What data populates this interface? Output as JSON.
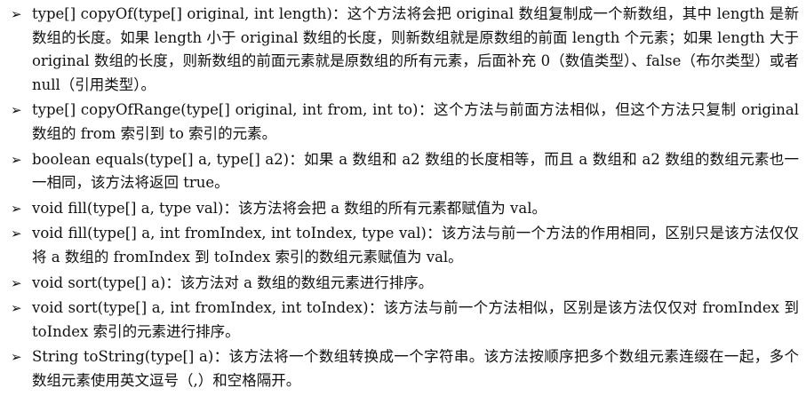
{
  "document": {
    "bullet_glyph": "➢",
    "items": [
      {
        "text": "type[] copyOf(type[] original, int length)：这个方法将会把 original 数组复制成一个新数组，其中 length 是新数组的长度。如果 length 小于 original 数组的长度，则新数组就是原数组的前面 length 个元素；如果 length 大于 original 数组的长度，则新数组的前面元素就是原数组的所有元素，后面补充 0（数值类型）、false（布尔类型）或者 null（引用类型）。"
      },
      {
        "text": "type[] copyOfRange(type[] original, int from, int to)：这个方法与前面方法相似，但这个方法只复制 original 数组的 from 索引到 to 索引的元素。"
      },
      {
        "text": "boolean equals(type[] a, type[] a2)：如果 a 数组和 a2 数组的长度相等，而且 a 数组和 a2 数组的数组元素也一一相同，该方法将返回 true。"
      },
      {
        "text": "void fill(type[] a, type val)：该方法将会把 a 数组的所有元素都赋值为 val。"
      },
      {
        "text": "void fill(type[] a, int fromIndex, int toIndex, type val)：该方法与前一个方法的作用相同，区别只是该方法仅仅将 a 数组的 fromIndex 到 toIndex 索引的数组元素赋值为 val。"
      },
      {
        "text": "void sort(type[] a)：该方法对 a 数组的数组元素进行排序。"
      },
      {
        "text": "void sort(type[] a, int fromIndex, int toIndex)：该方法与前一个方法相似，区别是该方法仅仅对 fromIndex 到 toIndex 索引的元素进行排序。"
      },
      {
        "text": "String toString(type[] a)：该方法将一个数组转换成一个字符串。该方法按顺序把多个数组元素连缀在一起，多个数组元素使用英文逗号（,）和空格隔开。"
      }
    ]
  }
}
